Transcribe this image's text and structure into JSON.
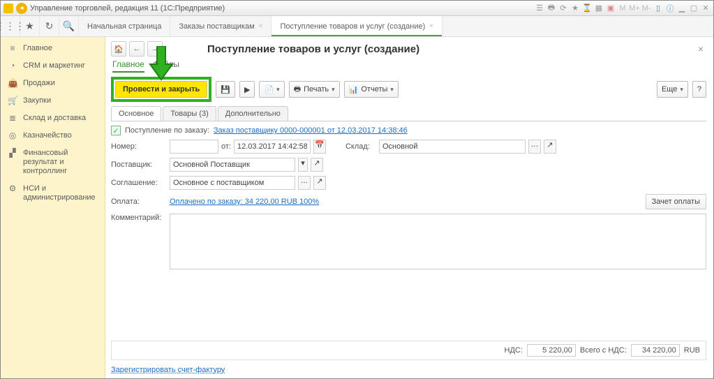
{
  "titlebar": {
    "title": "Управление торговлей, редакция 11  (1С:Предприятие)"
  },
  "tabs": {
    "t0": "Начальная страница",
    "t1": "Заказы поставщикам",
    "t2": "Поступление товаров и услуг (создание)"
  },
  "sidebar": {
    "main": "Главное",
    "crm": "CRM и маркетинг",
    "sales": "Продажи",
    "purch": "Закупки",
    "stock": "Склад и доставка",
    "treasury": "Казначейство",
    "fin": "Финансовый результат и контроллинг",
    "nsi": "НСИ и администрирование"
  },
  "page": {
    "title": "Поступление товаров и услуг (создание)",
    "subtab_main": "Главное",
    "subtab_files": "Файлы"
  },
  "toolbar": {
    "post_close": "Провести и закрыть",
    "print": "Печать",
    "reports": "Отчеты",
    "more": "Еще",
    "help": "?"
  },
  "innerTabs": {
    "main": "Основное",
    "goods": "Товары (3)",
    "extra": "Дополнительно"
  },
  "form": {
    "order_lbl": "Поступление по заказу:",
    "order_link": "Заказ поставщику 0000-000001 от 12.03.2017 14:38:46",
    "number_lbl": "Номер:",
    "number_val": "",
    "ot": "от:",
    "date_val": "12.03.2017 14:42:58",
    "store_lbl": "Склад:",
    "store_val": "Основной",
    "supplier_lbl": "Поставщик:",
    "supplier_val": "Основной Поставщик",
    "agreement_lbl": "Соглашение:",
    "agreement_val": "Основное с поставщиком",
    "payment_lbl": "Оплата:",
    "payment_link": "Оплачено по заказу: 34 220,00 RUB  100%",
    "offset_btn": "Зачет оплаты",
    "comment_lbl": "Комментарий:"
  },
  "footer": {
    "nds_lbl": "НДС:",
    "nds_val": "5 220,00",
    "total_lbl": "Всего с НДС:",
    "total_val": "34 220,00",
    "currency": "RUB",
    "reg_link": "Зарегистрировать счет-фактуру"
  }
}
